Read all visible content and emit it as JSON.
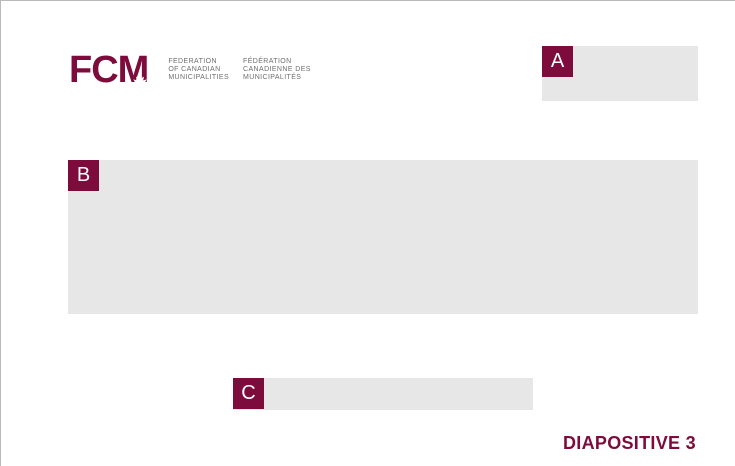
{
  "colors": {
    "brand": "#7d0b3c",
    "placeholder": "#e7e7e7",
    "text_muted": "#6d6e70"
  },
  "logo": {
    "mark": "FCM",
    "icon": "maple-leaf-icon",
    "english": [
      "FEDERATION",
      "OF CANADIAN",
      "MUNICIPALITIES"
    ],
    "french": [
      "FÉDÉRATION",
      "CANADIENNE DES",
      "MUNICIPALITÉS"
    ]
  },
  "placeholders": [
    {
      "tag": "A"
    },
    {
      "tag": "B"
    },
    {
      "tag": "C"
    }
  ],
  "footer": {
    "label": "DIAPOSITIVE 3"
  }
}
